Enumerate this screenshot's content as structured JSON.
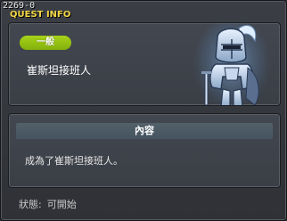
{
  "window": {
    "quest_id": "2269-0",
    "title": "QUEST INFO"
  },
  "quest": {
    "category": "一般",
    "name": "崔斯坦接班人",
    "portrait_icon": "armored-knight-icon"
  },
  "content": {
    "header": "內容",
    "text": "成為了崔斯坦接班人。"
  },
  "status": {
    "label": "狀態:",
    "value": "可開始"
  },
  "colors": {
    "title": "#f2d544",
    "badge": "#96c412",
    "background": "#33363b"
  }
}
